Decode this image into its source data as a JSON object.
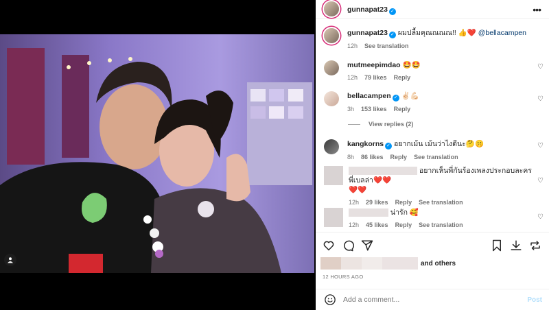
{
  "post": {
    "author": "gunnapat23",
    "caption": {
      "text": "ผมปลื้มคุณณณณ!! 👍❤️",
      "mention": "@bellacampen",
      "age": "12h",
      "see_translation": "See translation"
    }
  },
  "comments": [
    {
      "user": "mutmeepimdao",
      "verified": false,
      "text": "🤩🤩",
      "age": "12h",
      "likes": "79 likes",
      "reply": "Reply",
      "translation": ""
    },
    {
      "user": "bellacampen",
      "verified": true,
      "text": "✌🏻💪🏻",
      "age": "3h",
      "likes": "153 likes",
      "reply": "Reply",
      "translation": ""
    },
    {
      "user": "kangkorns",
      "verified": true,
      "text": "อยากเม้น เม้นว่าไงดีนะ🤔🤫",
      "age": "8h",
      "likes": "86 likes",
      "reply": "Reply",
      "translation": "See translation"
    },
    {
      "user": "",
      "verified": false,
      "text": "อยากเห็นพี่กันร้องเพลงประกอบละครพี่เบลล่า❤️❤️",
      "text2": "❤️❤️",
      "age": "12h",
      "likes": "29 likes",
      "reply": "Reply",
      "translation": "See translation"
    },
    {
      "user": "",
      "verified": false,
      "text": "น่ารัก 🥰",
      "age": "12h",
      "likes": "45 likes",
      "reply": "Reply",
      "translation": "See translation"
    }
  ],
  "view_replies": "View replies (2)",
  "likes_summary": "and others",
  "timestamp": "12 HOURS AGO",
  "comment_input": {
    "placeholder": "Add a comment..."
  },
  "post_button": "Post",
  "icons": {
    "like": "heart-icon",
    "comment": "comment-icon",
    "share": "send-icon",
    "save": "bookmark-icon",
    "download": "download-icon",
    "repost": "repost-icon",
    "emoji": "emoji-icon",
    "more": "more-icon",
    "user_tag": "user-tag-icon"
  },
  "colors": {
    "verified": "#0095f6",
    "link": "#00376b",
    "post_disabled": "#b2dffc",
    "muted": "#737373"
  }
}
